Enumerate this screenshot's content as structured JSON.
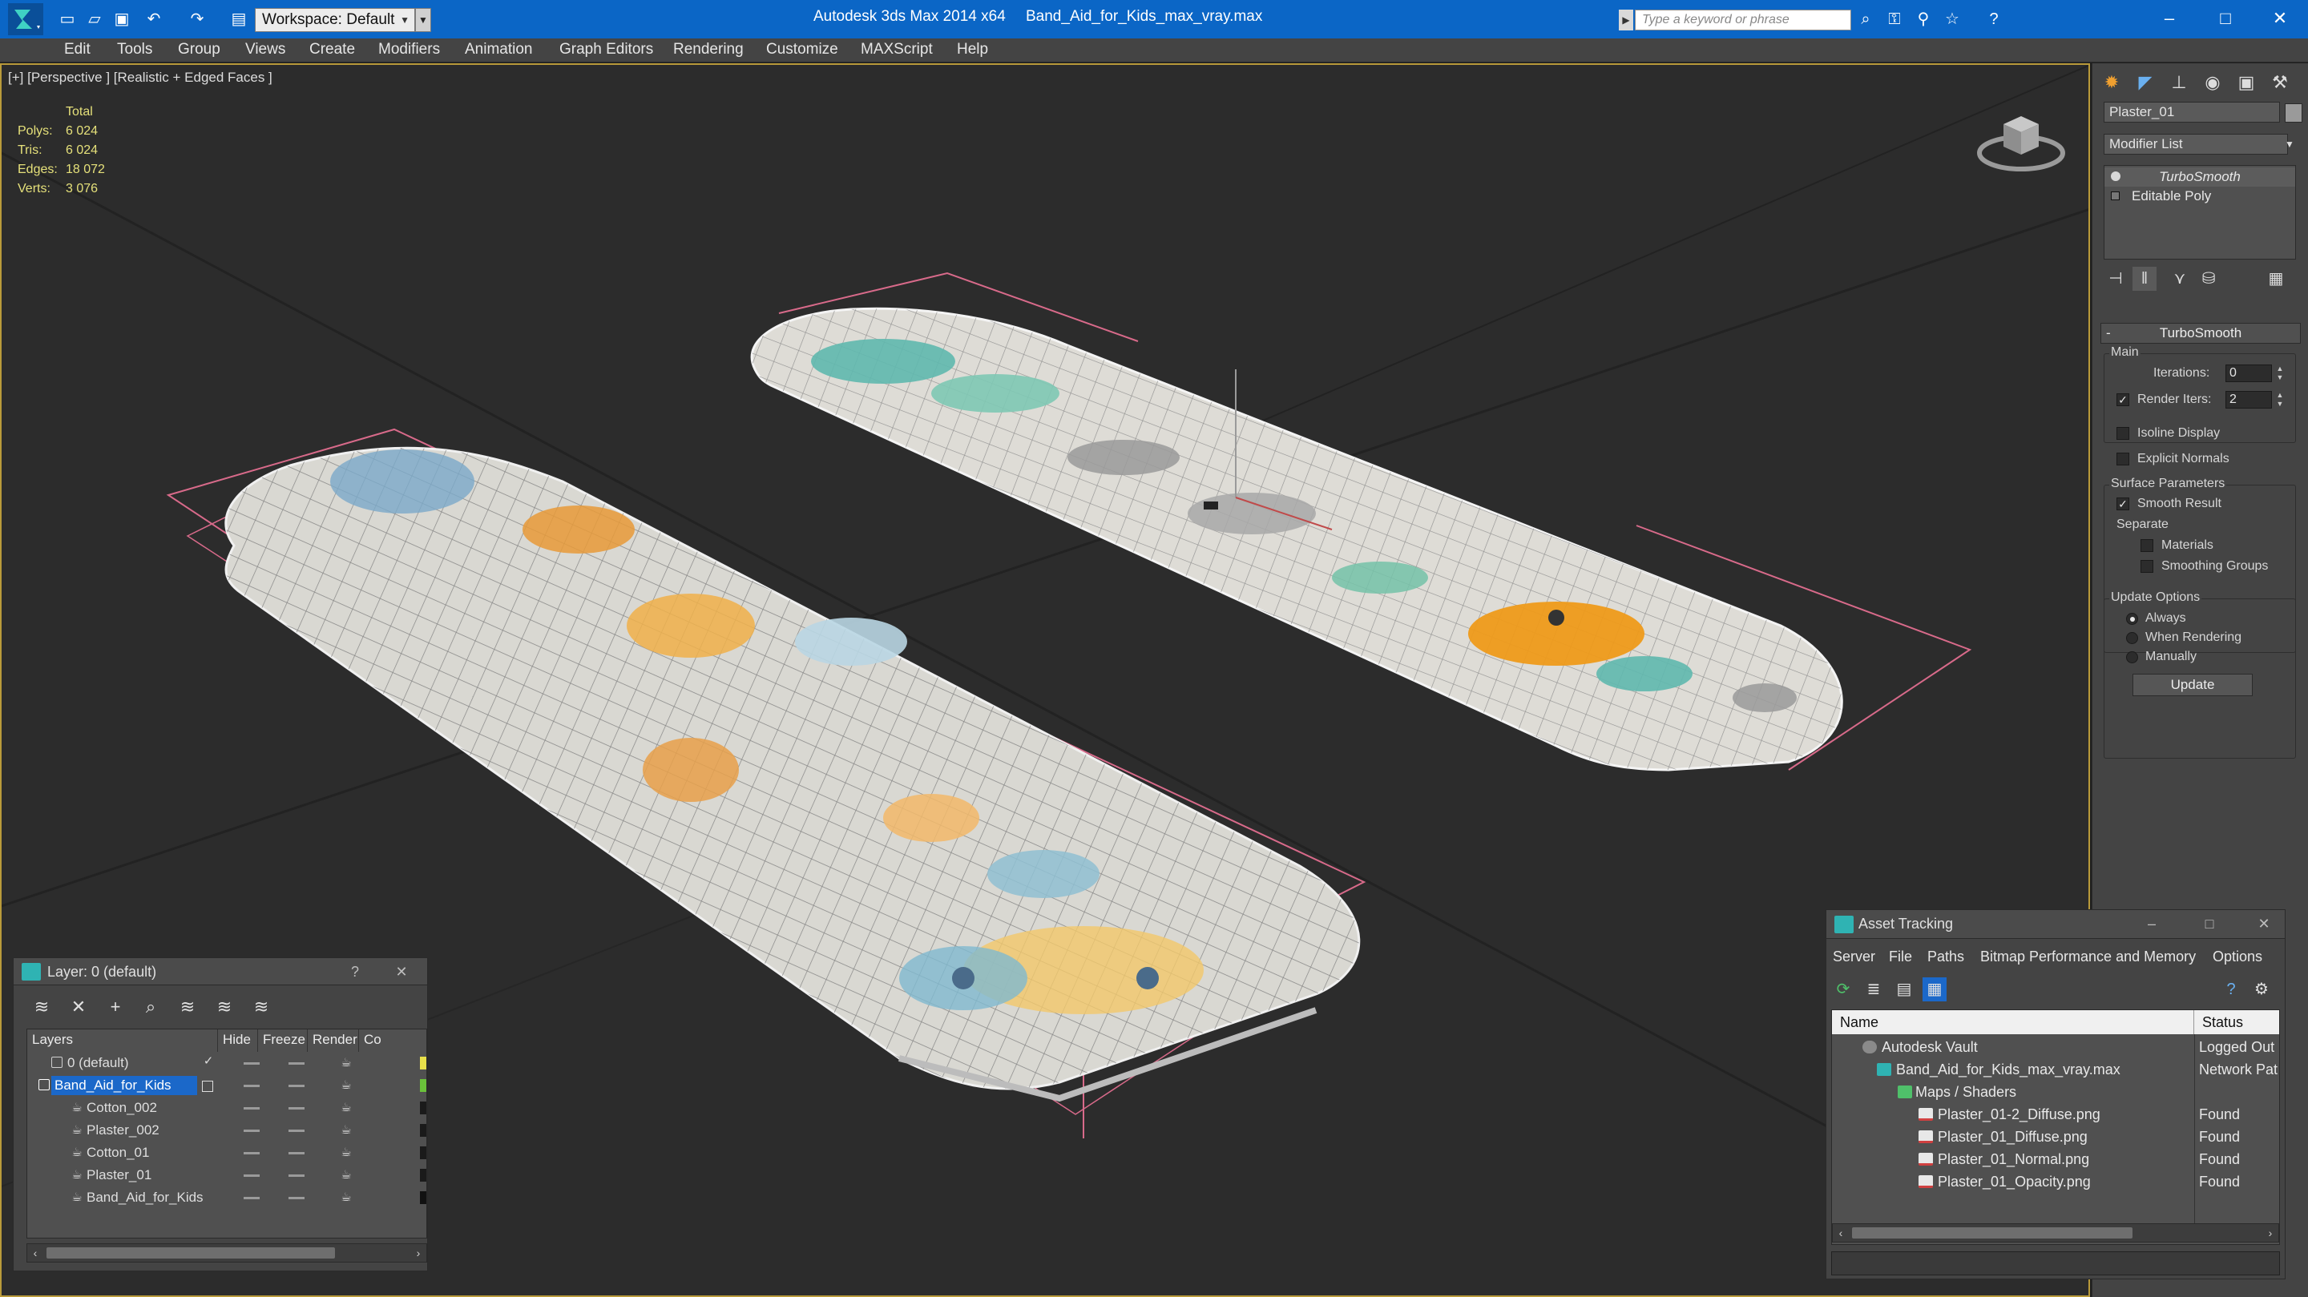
{
  "titlebar": {
    "app_title": "Autodesk 3ds Max  2014 x64",
    "file_title": "Band_Aid_for_Kids_max_vray.max",
    "workspace_label": "Workspace: Default",
    "search_placeholder": "Type a keyword or phrase"
  },
  "menu": {
    "items": [
      "Edit",
      "Tools",
      "Group",
      "Views",
      "Create",
      "Modifiers",
      "Animation",
      "Graph Editors",
      "Rendering",
      "Customize",
      "MAXScript",
      "Help"
    ]
  },
  "viewport": {
    "label": "[+] [Perspective ] [Realistic + Edged Faces ]",
    "stats": {
      "header": "Total",
      "rows": [
        {
          "key": "Polys:",
          "value": "6 024"
        },
        {
          "key": "Tris:",
          "value": "6 024"
        },
        {
          "key": "Edges:",
          "value": "18 072"
        },
        {
          "key": "Verts:",
          "value": "3 076"
        }
      ]
    }
  },
  "command_panel": {
    "object_name": "Plaster_01",
    "modifier_list": "Modifier List",
    "stack": [
      "TurboSmooth",
      "Editable Poly"
    ],
    "rollout_title": "TurboSmooth",
    "main_group": "Main",
    "iterations_label": "Iterations:",
    "iterations_value": "0",
    "render_iters_label": "Render Iters:",
    "render_iters_value": "2",
    "isoline_label": "Isoline Display",
    "explicit_normals_label": "Explicit Normals",
    "surface_group": "Surface Parameters",
    "smooth_result_label": "Smooth Result",
    "separate_label": "Separate",
    "materials_label": "Materials",
    "smoothing_groups_label": "Smoothing Groups",
    "update_group": "Update Options",
    "always_label": "Always",
    "when_rendering_label": "When Rendering",
    "manually_label": "Manually",
    "update_button": "Update",
    "accent": "#e8a23a"
  },
  "layer_explorer": {
    "title": "Layer: 0 (default)",
    "columns": [
      "Layers",
      "Hide",
      "Freeze",
      "Render",
      "Co"
    ],
    "rows": [
      {
        "name": "0 (default)",
        "color": "#e8e04a"
      },
      {
        "name": "Band_Aid_for_Kids",
        "color": "#6ac23a"
      },
      {
        "name": "Cotton_002",
        "color": "#1a1a1a"
      },
      {
        "name": "Plaster_002",
        "color": "#1a1a1a"
      },
      {
        "name": "Cotton_01",
        "color": "#1a1a1a"
      },
      {
        "name": "Plaster_01",
        "color": "#1a1a1a"
      },
      {
        "name": "Band_Aid_for_Kids",
        "color": "#111111"
      }
    ]
  },
  "asset_tracking": {
    "title": "Asset Tracking",
    "menu": [
      "Server",
      "File",
      "Paths",
      "Bitmap Performance and Memory",
      "Options"
    ],
    "columns": [
      "Name",
      "Status"
    ],
    "rows": [
      {
        "name": "Autodesk Vault",
        "status": "Logged Out"
      },
      {
        "name": "Band_Aid_for_Kids_max_vray.max",
        "status": "Network Pat"
      },
      {
        "name": "Maps / Shaders",
        "status": ""
      },
      {
        "name": "Plaster_01-2_Diffuse.png",
        "status": "Found"
      },
      {
        "name": "Plaster_01_Diffuse.png",
        "status": "Found"
      },
      {
        "name": "Plaster_01_Normal.png",
        "status": "Found"
      },
      {
        "name": "Plaster_01_Opacity.png",
        "status": "Found"
      }
    ]
  }
}
